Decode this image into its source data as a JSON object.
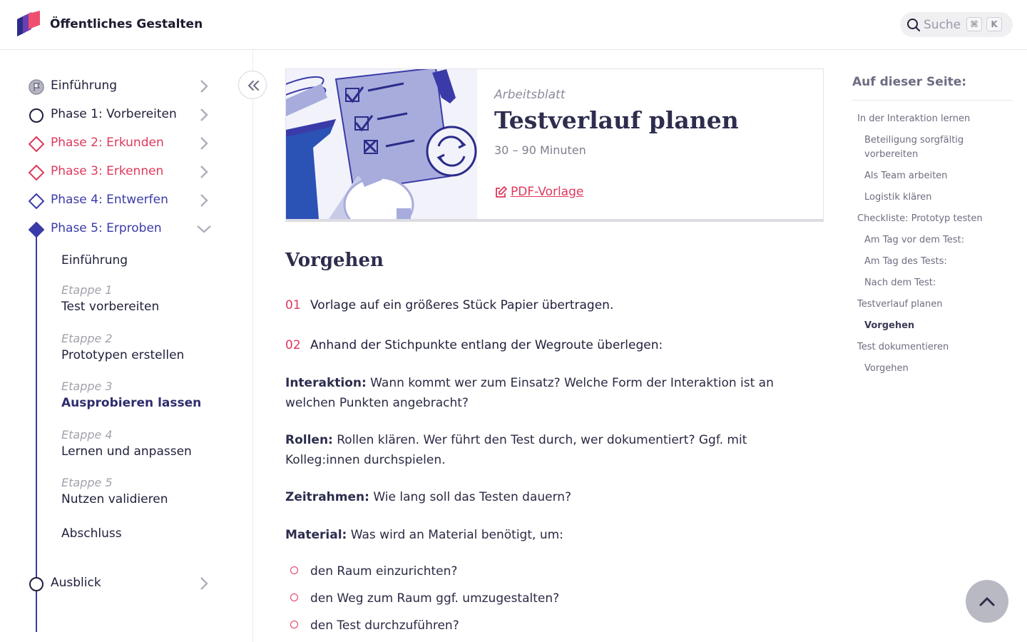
{
  "header": {
    "brand": "Öffentliches Gestalten",
    "search_placeholder": "Suche",
    "kbd_cmd": "⌘",
    "kbd_k": "K"
  },
  "colors": {
    "accent_pink": "#e0385c",
    "accent_indigo": "#3a3ba8",
    "dark": "#2d2d4e"
  },
  "sidebar": {
    "phases": [
      {
        "label": "Einführung",
        "icon": "flag-icon",
        "color": "#1f1f3a"
      },
      {
        "label": "Phase 1: Vorbereiten",
        "icon": "circle-icon",
        "color": "#1f1f3a"
      },
      {
        "label": "Phase 2: Erkunden",
        "icon": "diamond-icon",
        "color": "#e0385c"
      },
      {
        "label": "Phase 3: Erkennen",
        "icon": "diamond-icon",
        "color": "#e0385c"
      },
      {
        "label": "Phase 4: Entwerfen",
        "icon": "diamond-icon",
        "color": "#3a3ba8"
      },
      {
        "label": "Phase 5: Erproben",
        "icon": "filled-diamond-icon",
        "color": "#3a3ba8"
      }
    ],
    "phase5_sub": {
      "intro": "Einführung",
      "stages": [
        {
          "stage": "Etappe 1",
          "title": "Test vorbereiten"
        },
        {
          "stage": "Etappe 2",
          "title": "Prototypen erstellen"
        },
        {
          "stage": "Etappe 3",
          "title": "Ausprobieren lassen"
        },
        {
          "stage": "Etappe 4",
          "title": "Lernen und anpassen"
        },
        {
          "stage": "Etappe 5",
          "title": "Nutzen validieren"
        }
      ],
      "outro": "Abschluss"
    },
    "ausblick": "Ausblick"
  },
  "card": {
    "kicker": "Arbeitsblatt",
    "title": "Testverlauf planen",
    "duration": "30 – 90 Minuten",
    "link": "PDF-Vorlage"
  },
  "main": {
    "heading": "Vorgehen",
    "steps": [
      {
        "num": "01",
        "text": "Vorlage auf ein größeres Stück Papier übertragen."
      },
      {
        "num": "02",
        "text": "Anhand der Stichpunkte entlang der Wegroute überlegen:"
      }
    ],
    "items": [
      {
        "term": "Interaktion:",
        "text": " Wann kommt wer zum Einsatz? Welche Form der Interaktion ist an welchen Punkten angebracht?"
      },
      {
        "term": "Rollen:",
        "text": " Rollen klären. Wer führt den Test durch, wer dokumentiert? Ggf. mit Kolleg:innen durchspielen."
      },
      {
        "term": "Zeitrahmen:",
        "text": " Wie lang soll das Testen dauern?"
      },
      {
        "term": "Material:",
        "text": " Was wird an Material benötigt, um:"
      }
    ],
    "bullets": [
      "den Raum einzurichten?",
      "den Weg zum Raum ggf. umzugestalten?",
      "den Test durchzuführen?"
    ]
  },
  "toc": {
    "title": "Auf dieser Seite:",
    "items": [
      {
        "label": "In der Interaktion lernen",
        "level": 1
      },
      {
        "label": "Beteiligung sorgfältig vorbereiten",
        "level": 2
      },
      {
        "label": "Als Team arbeiten",
        "level": 2
      },
      {
        "label": "Logistik klären",
        "level": 2
      },
      {
        "label": "Checkliste: Prototyp testen",
        "level": 1
      },
      {
        "label": "Am Tag vor dem Test:",
        "level": 2
      },
      {
        "label": "Am Tag des Tests:",
        "level": 2
      },
      {
        "label": "Nach dem Test:",
        "level": 2
      },
      {
        "label": "Testverlauf planen",
        "level": 1
      },
      {
        "label": "Vorgehen",
        "level": 2,
        "active": true
      },
      {
        "label": "Test dokumentieren",
        "level": 1
      },
      {
        "label": "Vorgehen",
        "level": 2
      }
    ]
  }
}
